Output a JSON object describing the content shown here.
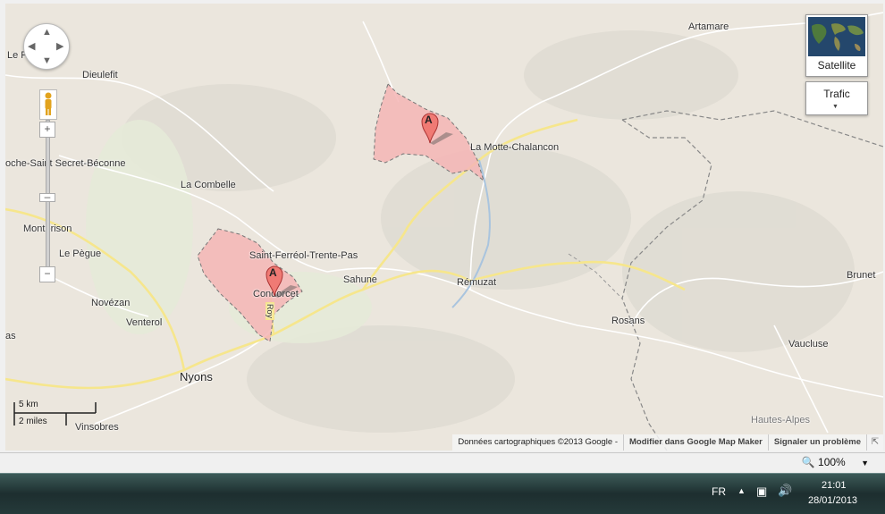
{
  "map": {
    "places": [
      {
        "name": "Le P"
      },
      {
        "name": "Dieulefit"
      },
      {
        "name": "oche-Saint Secret-Béconne"
      },
      {
        "name": "La Combelle"
      },
      {
        "name": "Montbrison"
      },
      {
        "name": "Le Pègue"
      },
      {
        "name": "Novézan"
      },
      {
        "name": "Venterol"
      },
      {
        "name": "as"
      },
      {
        "name": "Nyons"
      },
      {
        "name": "Vinsobres"
      },
      {
        "name": "Saint-Ferréol-Trente-Pas"
      },
      {
        "name": "Condorcet"
      },
      {
        "name": "Sahune"
      },
      {
        "name": "Rémuzat"
      },
      {
        "name": "La Motte-Chalancon"
      },
      {
        "name": "Artamare"
      },
      {
        "name": "Rosans"
      },
      {
        "name": "Brunet"
      },
      {
        "name": "Vaucluse"
      },
      {
        "name": "Hautes-Alpes"
      },
      {
        "name": "Roy"
      }
    ],
    "markers": [
      {
        "label": "A"
      },
      {
        "label": "A"
      }
    ],
    "controls": {
      "satellite_label": "Satellite",
      "traffic_label": "Trafic",
      "zoom_in": "+",
      "zoom_out": "−"
    },
    "scale": {
      "km": "5 km",
      "miles": "2 miles"
    },
    "attribution": {
      "data": "Données cartographiques ©2013 Google -",
      "edit": "Modifier dans Google Map Maker",
      "report": "Signaler un problème"
    }
  },
  "browser": {
    "zoom_level": "100%"
  },
  "taskbar": {
    "language": "FR",
    "time": "21:01",
    "date": "28/01/2013"
  }
}
